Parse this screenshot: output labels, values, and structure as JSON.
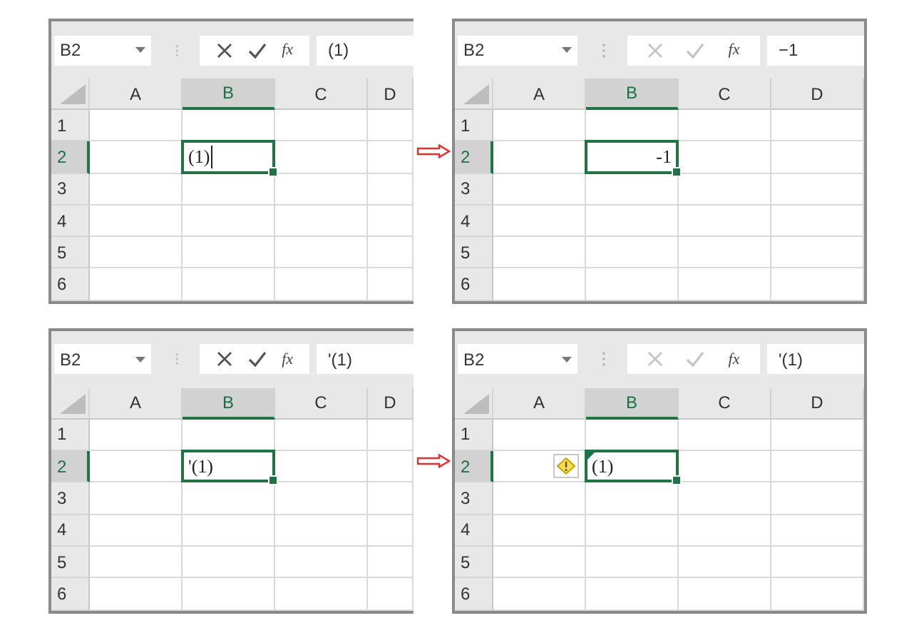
{
  "examples": [
    {
      "before": {
        "name_box": "B2",
        "function_label": "fx",
        "edit_mode": true,
        "formula": "(1)",
        "columns": [
          {
            "label": "A",
            "selected": false
          },
          {
            "label": "B",
            "selected": true
          },
          {
            "label": "C",
            "selected": false
          },
          {
            "label": "D",
            "selected": false
          }
        ],
        "rows": [
          {
            "label": "1",
            "selected": false
          },
          {
            "label": "2",
            "selected": true
          },
          {
            "label": "3",
            "selected": false
          },
          {
            "label": "4",
            "selected": false
          },
          {
            "label": "5",
            "selected": false
          },
          {
            "label": "6",
            "selected": false
          }
        ],
        "active_cell": {
          "text": "(1)",
          "kind": "text",
          "editing": true
        }
      },
      "after": {
        "name_box": "B2",
        "function_label": "fx",
        "edit_mode": false,
        "formula": "−1",
        "columns": [
          {
            "label": "A",
            "selected": false
          },
          {
            "label": "B",
            "selected": true
          },
          {
            "label": "C",
            "selected": false
          },
          {
            "label": "D",
            "selected": false
          }
        ],
        "rows": [
          {
            "label": "1",
            "selected": false
          },
          {
            "label": "2",
            "selected": true
          },
          {
            "label": "3",
            "selected": false
          },
          {
            "label": "4",
            "selected": false
          },
          {
            "label": "5",
            "selected": false
          },
          {
            "label": "6",
            "selected": false
          }
        ],
        "active_cell": {
          "text": "-1",
          "kind": "number",
          "editing": false
        }
      }
    },
    {
      "before": {
        "name_box": "B2",
        "function_label": "fx",
        "edit_mode": true,
        "formula": "'(1)",
        "columns": [
          {
            "label": "A",
            "selected": false
          },
          {
            "label": "B",
            "selected": true
          },
          {
            "label": "C",
            "selected": false
          },
          {
            "label": "D",
            "selected": false
          }
        ],
        "rows": [
          {
            "label": "1",
            "selected": false
          },
          {
            "label": "2",
            "selected": true
          },
          {
            "label": "3",
            "selected": false
          },
          {
            "label": "4",
            "selected": false
          },
          {
            "label": "5",
            "selected": false
          },
          {
            "label": "6",
            "selected": false
          }
        ],
        "active_cell": {
          "text": "'(1)",
          "kind": "text",
          "editing": false
        }
      },
      "after": {
        "name_box": "B2",
        "function_label": "fx",
        "edit_mode": false,
        "formula": "'(1)",
        "columns": [
          {
            "label": "A",
            "selected": false
          },
          {
            "label": "B",
            "selected": true
          },
          {
            "label": "C",
            "selected": false
          },
          {
            "label": "D",
            "selected": false
          }
        ],
        "rows": [
          {
            "label": "1",
            "selected": false
          },
          {
            "label": "2",
            "selected": true
          },
          {
            "label": "3",
            "selected": false
          },
          {
            "label": "4",
            "selected": false
          },
          {
            "label": "5",
            "selected": false
          },
          {
            "label": "6",
            "selected": false
          }
        ],
        "active_cell": {
          "text": "(1)",
          "kind": "text",
          "editing": false,
          "error_flag": true
        },
        "warning_icon": true
      }
    }
  ]
}
